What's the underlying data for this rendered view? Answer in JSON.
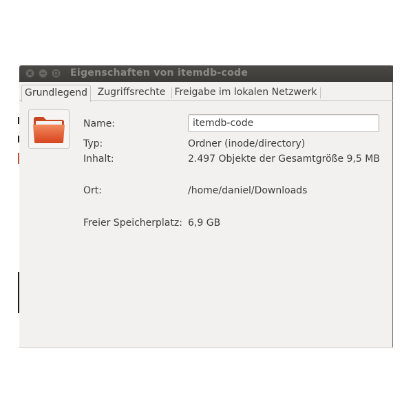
{
  "window": {
    "title": "Eigenschaften von itemdb-code",
    "controls": [
      "close-icon",
      "minimize-icon",
      "maximize-icon"
    ]
  },
  "tabs": [
    {
      "label": "Grundlegend",
      "active": true
    },
    {
      "label": "Zugriffsrechte",
      "active": false
    },
    {
      "label": "Freigabe im lokalen Netzwerk",
      "active": false
    }
  ],
  "properties": {
    "icon": "folder-icon",
    "name_label": "Name:",
    "name_value": "itemdb-code",
    "type_label": "Typ:",
    "type_value": "Ordner (inode/directory)",
    "content_label": "Inhalt:",
    "content_value": "2.497 Objekte der Gesamtgröße 9,5 MB",
    "location_label": "Ort:",
    "location_value": "/home/daniel/Downloads",
    "free_space_label": "Freier Speicherplatz:",
    "free_space_value": "6,9 GB"
  },
  "colors": {
    "titlebar": "#3c3b37",
    "window_bg": "#f2f1f0",
    "folder_orange": "#e2572e"
  }
}
